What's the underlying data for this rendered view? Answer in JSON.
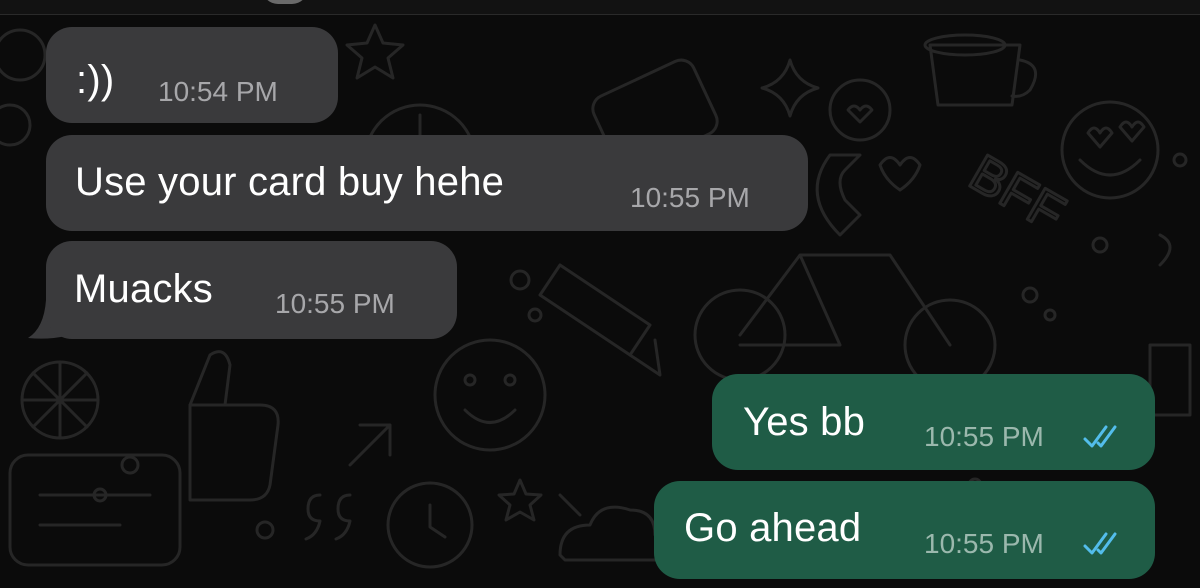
{
  "chat": {
    "messages": [
      {
        "text": ":))",
        "time": "10:54 PM",
        "direction": "incoming"
      },
      {
        "text": "Use your card buy hehe",
        "time": "10:55 PM",
        "direction": "incoming"
      },
      {
        "text": "Muacks",
        "time": "10:55 PM",
        "direction": "incoming"
      },
      {
        "text": "Yes bb",
        "time": "10:55 PM",
        "direction": "outgoing",
        "status_icon": "double-check-icon"
      },
      {
        "text": "Go ahead",
        "time": "10:55 PM",
        "direction": "outgoing",
        "status_icon": "double-check-icon"
      }
    ]
  },
  "colors": {
    "background": "#0b0b0b",
    "incoming_bubble": "#3a3a3c",
    "outgoing_bubble": "#1f5c46",
    "read_ticks": "#53bdeb"
  }
}
